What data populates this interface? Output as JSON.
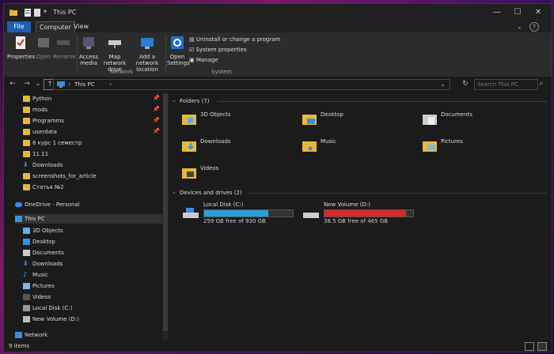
{
  "window": {
    "title": "This PC"
  },
  "menu": {
    "file": "File",
    "computer": "Computer",
    "view": "View"
  },
  "ribbon": {
    "location": {
      "properties": "Properties",
      "open": "Open",
      "rename": "Rename"
    },
    "network": {
      "access_media": "Access media",
      "map_network_drive": "Map network drive",
      "add_network_location": "Add a network location",
      "label": "Network"
    },
    "system": {
      "open_settings": "Open Settings",
      "uninstall": "Uninstall or change a program",
      "system_properties": "System properties",
      "manage": "Manage",
      "label": "System"
    }
  },
  "address": {
    "path": "This PC",
    "search_placeholder": "Search This PC"
  },
  "nav": {
    "quick_access": [
      {
        "label": "Python",
        "pinned": true
      },
      {
        "label": "mods",
        "pinned": true
      },
      {
        "label": "Programms",
        "pinned": true
      },
      {
        "label": "userdata",
        "pinned": true
      },
      {
        "label": "6 курс 1 семестр",
        "pinned": false
      },
      {
        "label": "11.11",
        "pinned": false
      },
      {
        "label": "Downloads",
        "pinned": false
      },
      {
        "label": "screenshots_for_article",
        "pinned": false
      },
      {
        "label": "Статья №2",
        "pinned": false
      }
    ],
    "onedrive": "OneDrive - Personal",
    "this_pc": "This PC",
    "this_pc_items": [
      "3D Objects",
      "Desktop",
      "Documents",
      "Downloads",
      "Music",
      "Pictures",
      "Videos",
      "Local Disk (C:)",
      "New Volume (D:)"
    ],
    "network": "Network"
  },
  "content": {
    "folders_header": "Folders (7)",
    "folders": [
      "3D Objects",
      "Desktop",
      "Documents",
      "Downloads",
      "Music",
      "Pictures",
      "Videos"
    ],
    "drives_header": "Devices and drives (2)",
    "drives": [
      {
        "name": "Local Disk (C:)",
        "free": "259 GB free of 930 GB",
        "used_fraction": 0.72,
        "color": "#26a0da"
      },
      {
        "name": "New Volume (D:)",
        "free": "38.5 GB free of 465 GB",
        "used_fraction": 0.92,
        "color": "#da2626"
      }
    ]
  },
  "status": {
    "items": "9 items"
  }
}
